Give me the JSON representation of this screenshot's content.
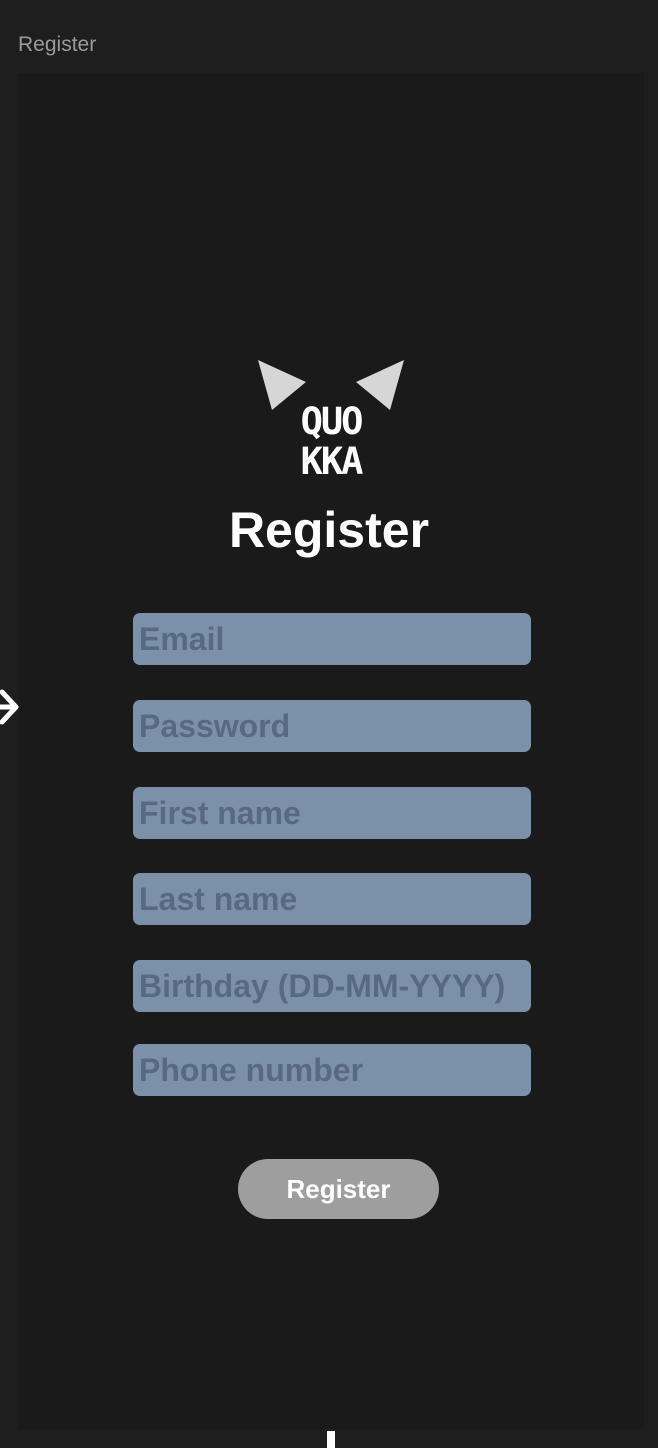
{
  "frame": {
    "label": "Register"
  },
  "logo": {
    "line1": "QUO",
    "line2": "KKA"
  },
  "page": {
    "title": "Register"
  },
  "form": {
    "fields": [
      {
        "placeholder": "Email",
        "value": ""
      },
      {
        "placeholder": "Password",
        "value": ""
      },
      {
        "placeholder": "First name",
        "value": ""
      },
      {
        "placeholder": "Last name",
        "value": ""
      },
      {
        "placeholder": "Birthday (DD-MM-YYYY)",
        "value": ""
      },
      {
        "placeholder": "Phone number",
        "value": ""
      }
    ],
    "submit_label": "Register"
  },
  "colors": {
    "background": "#1e1e1e",
    "frame": "#1a1a1a",
    "field": "#7b91aa",
    "placeholder": "#586a82",
    "button": "#9e9e9e",
    "text": "#ffffff"
  },
  "icons": {
    "prototype_arrow": "arrow-right-icon",
    "logo_ears": "cat-ears-icon"
  }
}
